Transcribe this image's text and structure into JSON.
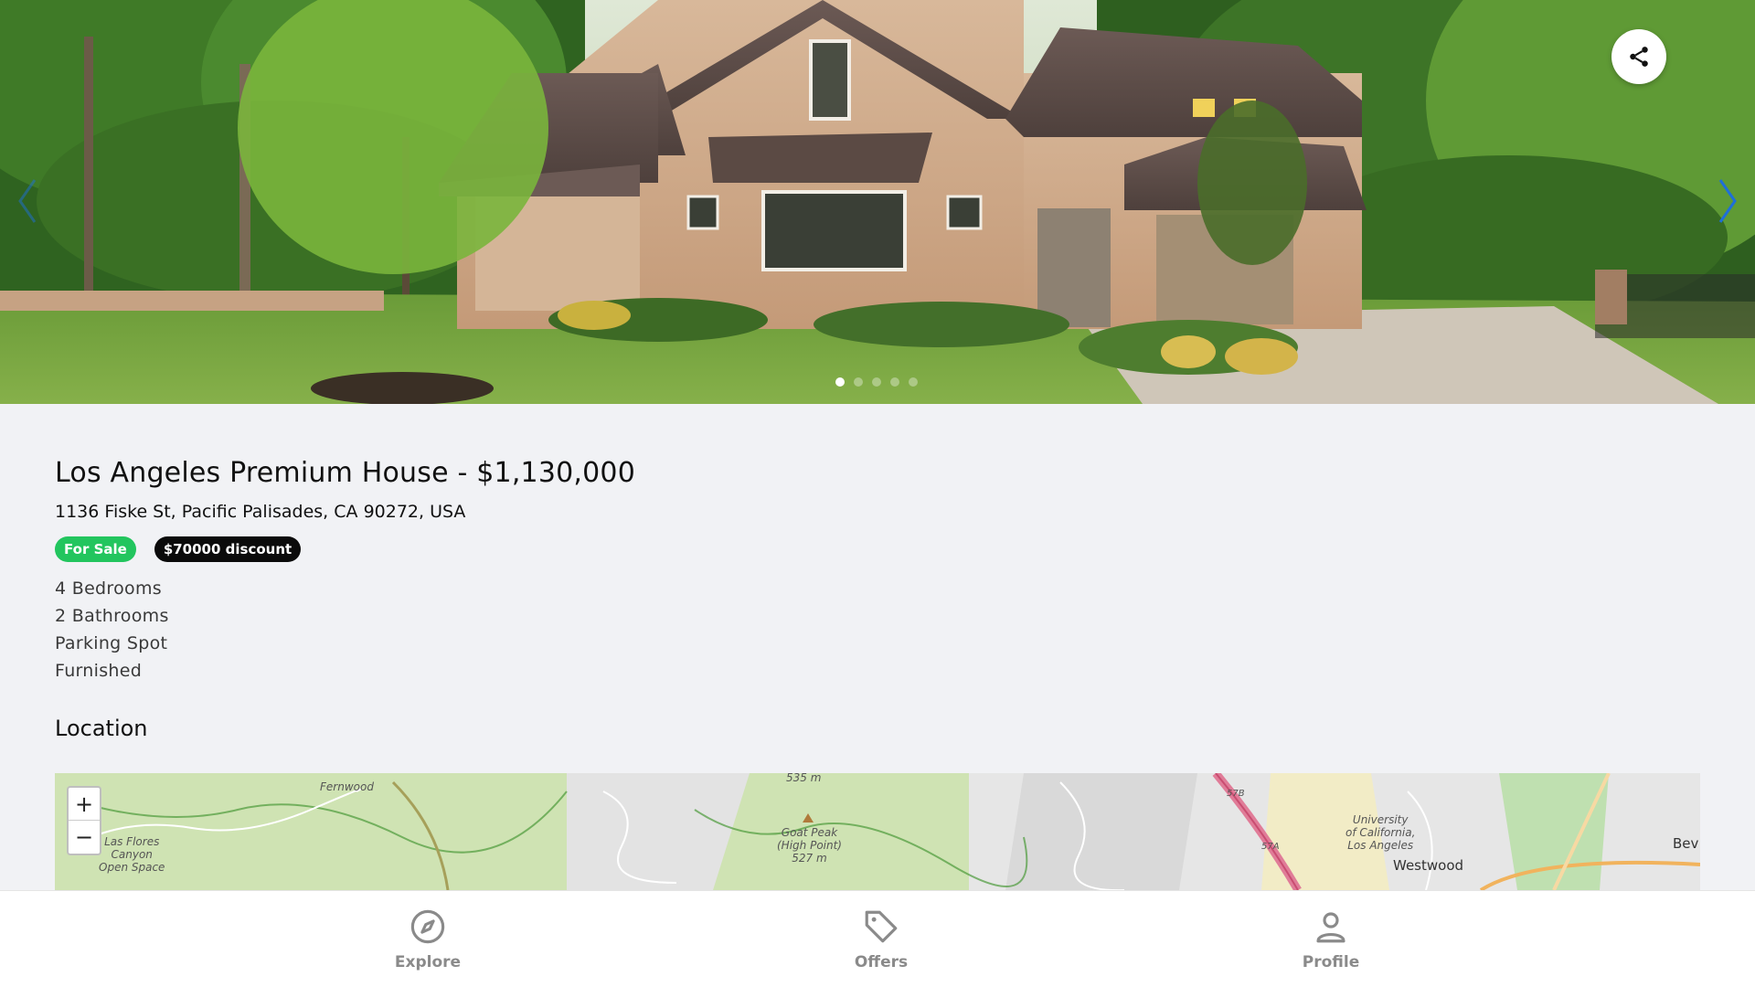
{
  "hero": {
    "image_alt": "Brick house with green lawn",
    "slide_count": 5,
    "active_slide": 0,
    "share_icon": "share-icon",
    "prev_icon": "chevron-left-icon",
    "next_icon": "chevron-right-icon"
  },
  "listing": {
    "title": "Los Angeles Premium House - $1,130,000",
    "address": "1136 Fiske St, Pacific Palisades, CA 90272, USA",
    "badges": [
      {
        "label": "For Sale",
        "color": "#22c55e"
      },
      {
        "label": "$70000 discount",
        "color": "#0b0b0b"
      }
    ],
    "features": [
      "4 Bedrooms",
      "2 Bathrooms",
      "Parking Spot",
      "Furnished"
    ]
  },
  "location": {
    "section_title": "Location",
    "zoom_in": "+",
    "zoom_out": "−",
    "labels": {
      "fernwood": "Fernwood",
      "elev_535": "535 m",
      "goat_peak": "Goat Peak\n(High Point)\n527 m",
      "los_flores": "Las Flores\nCanyon\nOpen Space",
      "ucla": "University\nof California,\nLos Angeles",
      "westwood": "Westwood",
      "bev": "Bev",
      "exit_57b": "57B",
      "exit_57a": "57A"
    }
  },
  "bottom_nav": {
    "items": [
      {
        "label": "Explore",
        "icon": "compass-icon"
      },
      {
        "label": "Offers",
        "icon": "tag-icon"
      },
      {
        "label": "Profile",
        "icon": "user-icon"
      }
    ]
  },
  "colors": {
    "accent_blue": "#1e6fd9",
    "sale_green": "#22c55e",
    "nav_gray": "#8a8a8a"
  }
}
